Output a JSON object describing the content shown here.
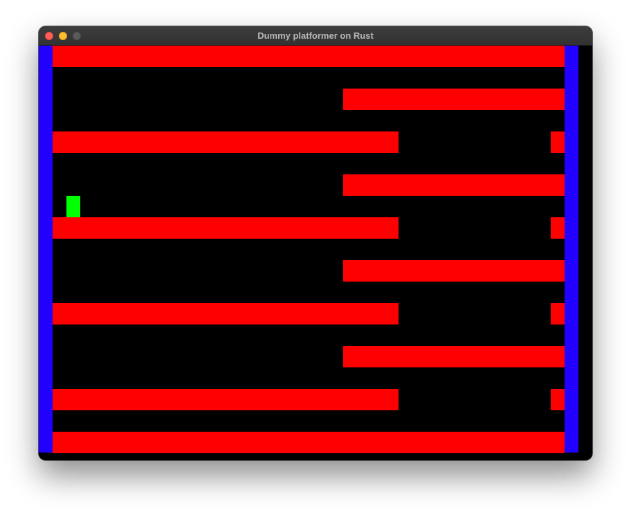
{
  "window": {
    "title": "Dummy platformer on Rust"
  },
  "icons": {
    "close": "close-traffic-light-icon",
    "minimize": "minimize-traffic-light-icon",
    "zoom": "zoom-traffic-light-icon"
  },
  "colors": {
    "background": "#000000",
    "wall": "#2200ff",
    "platform": "#ff0000",
    "player": "#00ff00"
  }
}
